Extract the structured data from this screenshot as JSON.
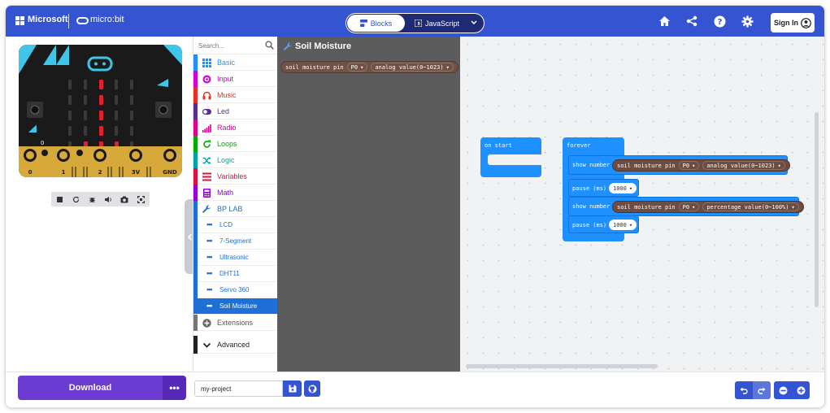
{
  "header": {
    "brand": "Microsoft",
    "product": "micro:bit",
    "tabs": {
      "blocks": "Blocks",
      "javascript": "JavaScript"
    },
    "signin": "Sign In",
    "icons": [
      "home-icon",
      "share-icon",
      "help-icon",
      "settings-icon"
    ]
  },
  "simulator": {
    "pins": [
      "0",
      "1",
      "2",
      "3V",
      "GND"
    ],
    "button_a": "A",
    "button_b": "B",
    "led_on_color": "#e0202a",
    "controls": [
      "stop-icon",
      "restart-icon",
      "debug-icon",
      "sound-icon",
      "screenshot-icon",
      "fullscreen-icon"
    ]
  },
  "toolbox": {
    "search_placeholder": "Search...",
    "categories": [
      {
        "label": "Basic",
        "color": "#1e90ff"
      },
      {
        "label": "Input",
        "color": "#d400d4"
      },
      {
        "label": "Music",
        "color": "#e63022"
      },
      {
        "label": "Led",
        "color": "#5c2d91"
      },
      {
        "label": "Radio",
        "color": "#e3008c"
      },
      {
        "label": "Loops",
        "color": "#00aa00"
      },
      {
        "label": "Logic",
        "color": "#00a4a6"
      },
      {
        "label": "Variables",
        "color": "#dc143c"
      },
      {
        "label": "Math",
        "color": "#9400d3"
      },
      {
        "label": "BP LAB",
        "color": "#1e6fd6"
      }
    ],
    "subcategories": [
      "LCD",
      "7-Segment",
      "Ultrasonic",
      "DHT11",
      "Servo 360",
      "Soil Moisture"
    ],
    "extensions": "Extensions",
    "advanced": "Advanced"
  },
  "flyout": {
    "title": "Soil Moisture",
    "block": {
      "text": "soil moisture pin",
      "pin": "P0",
      "mode": "analog value(0~1023)"
    }
  },
  "workspace": {
    "on_start": "on start",
    "forever": "forever",
    "statements": [
      {
        "label": "show number",
        "reporter": "soil moisture pin",
        "pin": "P0",
        "mode": "analog value(0~1023)"
      },
      {
        "label": "pause (ms)",
        "value": "1000"
      },
      {
        "label": "show number",
        "reporter": "soil moisture pin",
        "pin": "P0",
        "mode": "percentage value(0~100%)"
      },
      {
        "label": "pause (ms)",
        "value": "1000"
      }
    ]
  },
  "footer": {
    "download": "Download",
    "more": "•••",
    "project_name": "my-project"
  }
}
